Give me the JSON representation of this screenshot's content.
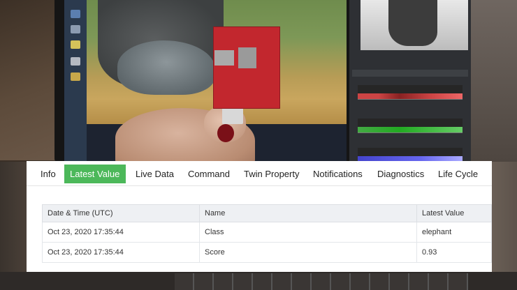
{
  "tabs": [
    {
      "label": "Info",
      "active": false
    },
    {
      "label": "Latest Value",
      "active": true
    },
    {
      "label": "Live Data",
      "active": false
    },
    {
      "label": "Command",
      "active": false
    },
    {
      "label": "Twin Property",
      "active": false
    },
    {
      "label": "Notifications",
      "active": false
    },
    {
      "label": "Diagnostics",
      "active": false
    },
    {
      "label": "Life Cycle",
      "active": false
    }
  ],
  "table": {
    "headers": [
      "Date & Time (UTC)",
      "Name",
      "Latest Value"
    ],
    "rows": [
      [
        "Oct 23, 2020 17:35:44",
        "Class",
        "elephant"
      ],
      [
        "Oct 23, 2020 17:35:44",
        "Score",
        "0.93"
      ]
    ]
  },
  "colors": {
    "active_tab": "#4cb85a",
    "device_board": "#c2272e"
  }
}
